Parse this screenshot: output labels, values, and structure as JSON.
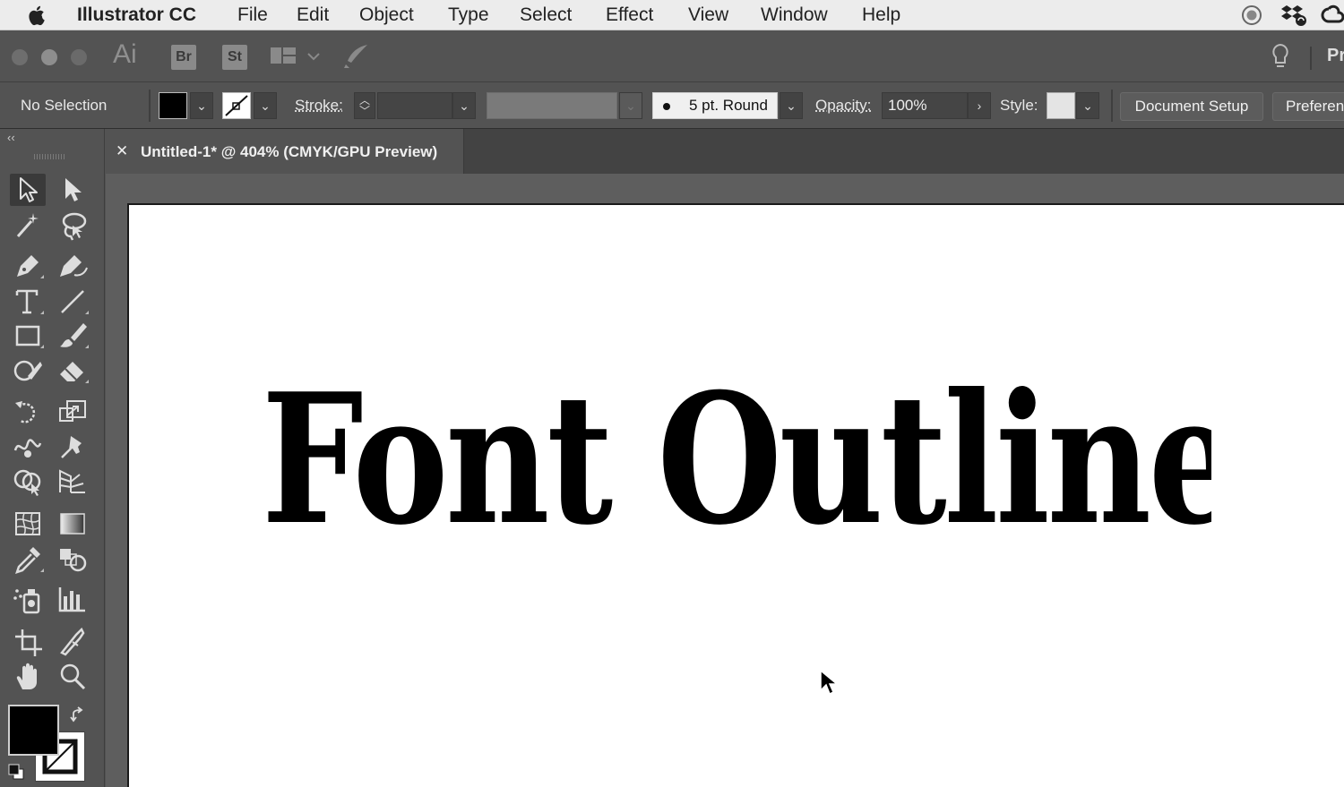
{
  "menubar": {
    "app_name": "Illustrator CC",
    "items": [
      "File",
      "Edit",
      "Object",
      "Type",
      "Select",
      "Effect",
      "View",
      "Window",
      "Help"
    ]
  },
  "appbar": {
    "logo": "Ai",
    "bridge": "Br",
    "stock": "St",
    "right_label": "Pr"
  },
  "control": {
    "selection": "No Selection",
    "stroke_label": "Stroke:",
    "brush": "5 pt. Round",
    "opacity_label": "Opacity:",
    "opacity_value": "100%",
    "style_label": "Style:",
    "doc_setup": "Document Setup",
    "preferences": "Preferen"
  },
  "document": {
    "tab_title": "Untitled-1* @ 404% (CMYK/GPU Preview)",
    "close_glyph": "✕"
  },
  "artwork": {
    "text": "Font Outline",
    "fill_color": "#000000"
  },
  "toolbox": {
    "collapse": "‹‹",
    "tools": [
      "selection-tool",
      "direct-selection-tool",
      "magic-wand-tool",
      "lasso-tool",
      "pen-tool",
      "curvature-tool",
      "type-tool",
      "line-segment-tool",
      "rectangle-tool",
      "paintbrush-tool",
      "shaper-tool",
      "eraser-tool",
      "rotate-tool",
      "scale-tool",
      "warp-tool",
      "puppet-warp-tool",
      "shape-builder-tool",
      "perspective-grid-tool",
      "mesh-tool",
      "gradient-tool",
      "eyedropper-tool",
      "blend-tool",
      "symbol-sprayer-tool",
      "column-graph-tool",
      "artboard-tool",
      "slice-tool",
      "hand-tool",
      "zoom-tool"
    ],
    "fill_color": "#000000",
    "stroke_color": "#ffffff"
  }
}
